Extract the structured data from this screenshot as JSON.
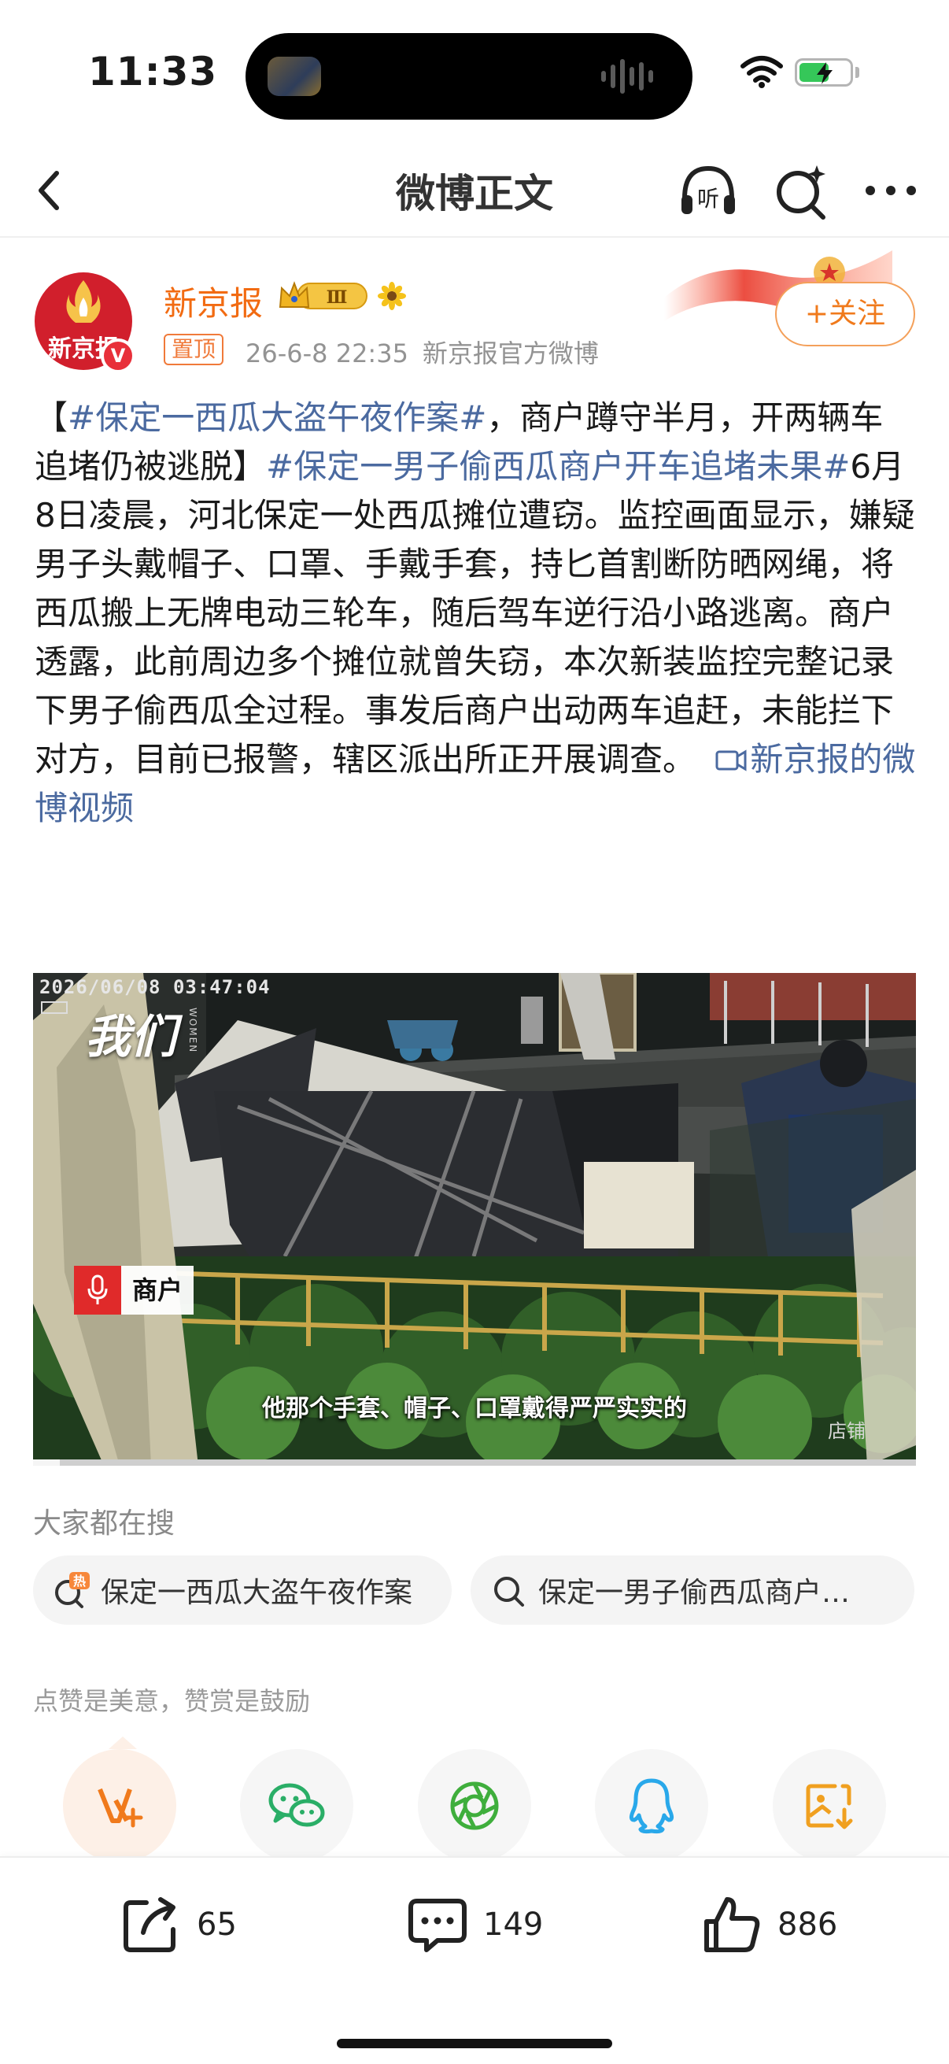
{
  "status_bar": {
    "time": "11:33",
    "battery_level": 0.55
  },
  "nav": {
    "title": "微博正文",
    "icons": [
      "back-arrow-icon",
      "headphones-listen-icon",
      "search-sparkle-icon",
      "more-dots-icon"
    ],
    "listen_label": "听"
  },
  "author": {
    "name": "新京报",
    "avatar_text": "新京报",
    "verified_badge": "V",
    "level_badge": "Ⅲ",
    "pin_tag": "置顶",
    "timestamp": "26-6-8 22:35",
    "source": "新京报官方微博",
    "follow_label": "+关注",
    "accent_color": "#f26b12"
  },
  "post": {
    "open_bracket": "【",
    "tag1": "#保定一西瓜大盗午夜作案#",
    "text1": "，商户蹲守半月，开两辆车追堵仍被逃脱】",
    "tag2": "#保定一男子偷西瓜商户开车追堵未果#",
    "body": "6月8日凌晨，河北保定一处西瓜摊位遭窃。监控画面显示，嫌疑男子头戴帽子、口罩、手戴手套，持匕首割断防晒网绳，将西瓜搬上无牌电动三轮车，随后驾车逆行沿小路逃离。商户透露，此前周边多个摊位就曾失窃，本次新装监控完整记录下男子偷西瓜全过程。事发后商户出动两车追赶，未能拦下对方，目前已报警，辖区派出所正开展调查。",
    "video_link": "新京报的微博视频",
    "link_color": "#4b6aa0"
  },
  "video": {
    "cctv_timestamp": "2026/06/08 03:47:04",
    "brand_logo": "我们",
    "brand_sub": "WOMEN",
    "speaker_label": "商户",
    "subtitle": "他那个手套、帽子、口罩戴得严严实实的",
    "corner_text": "店铺",
    "progress": 0.03
  },
  "hot_search": {
    "title": "大家都在搜",
    "items": [
      {
        "label": "保定一西瓜大盗午夜作案",
        "icon": "hot-search-icon",
        "hot_label": "热"
      },
      {
        "label": "保定一男子偷西瓜商户开车追堵未果",
        "icon": "search-icon"
      }
    ]
  },
  "reward": {
    "text": "点赞是美意，赞赏是鼓励",
    "share_targets": [
      "weibo-reward-icon",
      "wechat-icon",
      "moments-icon",
      "qq-icon",
      "save-image-icon"
    ]
  },
  "toolbar": {
    "reposts": "65",
    "comments": "149",
    "likes": "886"
  }
}
